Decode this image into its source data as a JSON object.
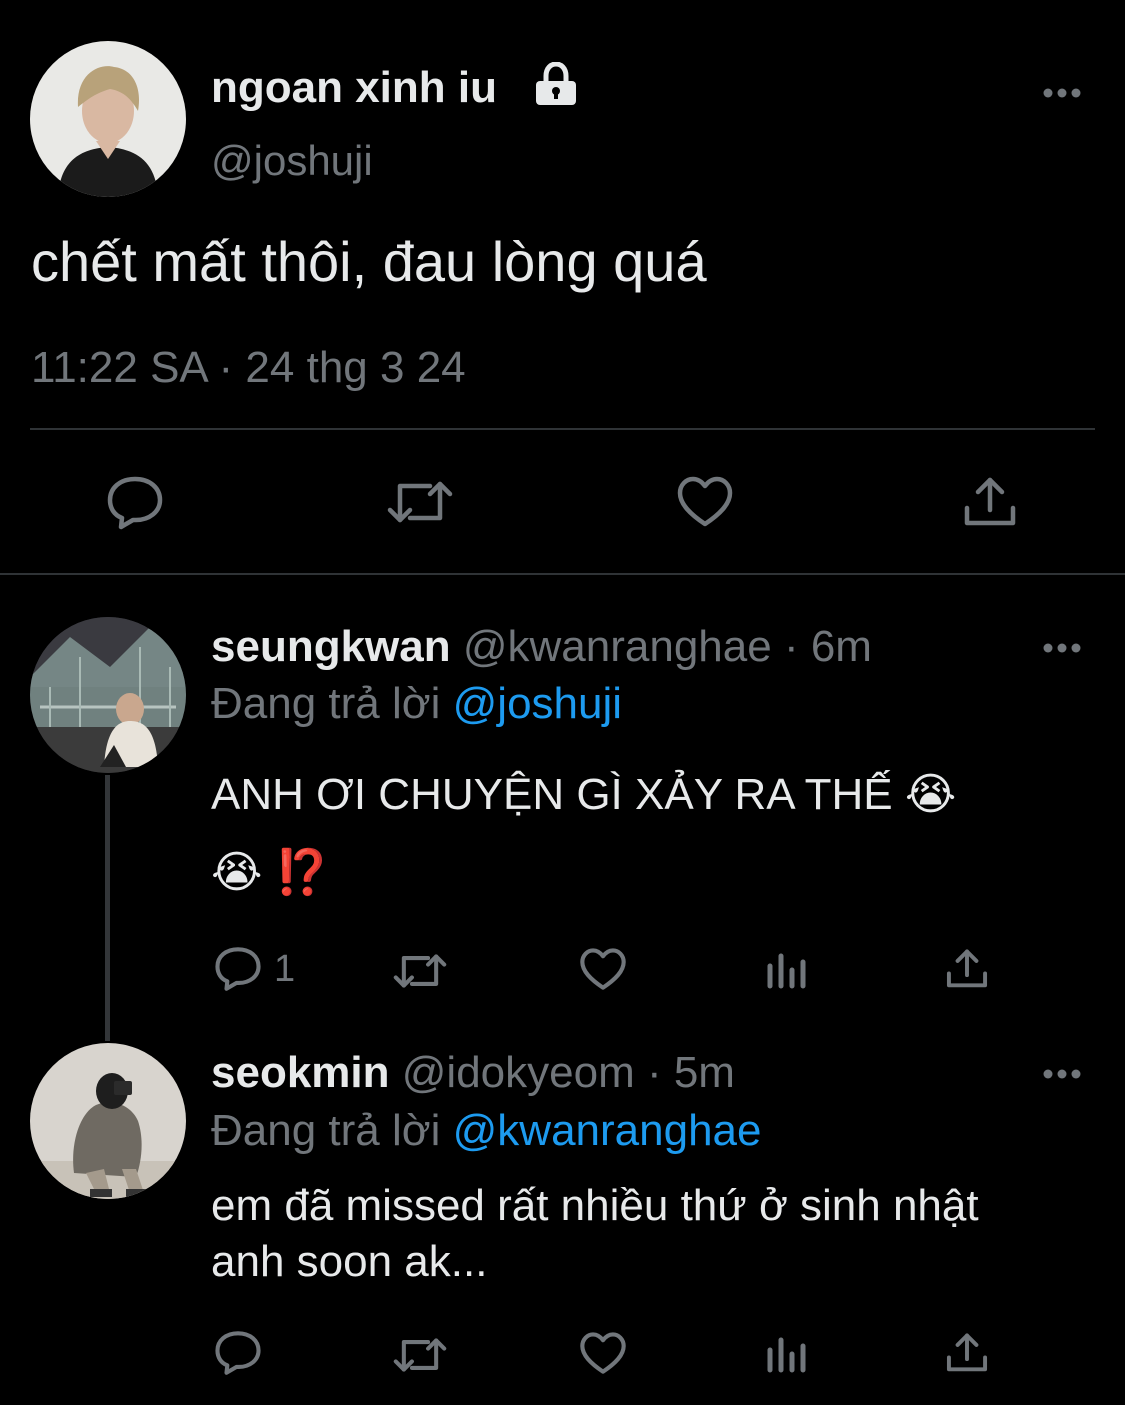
{
  "main_tweet": {
    "display_name": "ngoan xinh iu",
    "handle": "@joshuji",
    "text": "chết mất thôi, đau lòng quá",
    "timestamp": "11:22 SA · 24 thg 3 24",
    "icons": [
      "reply-icon",
      "retweet-icon",
      "like-icon",
      "share-icon"
    ]
  },
  "replies": [
    {
      "display_name": "seungkwan",
      "meta": "@kwanranghae · 6m",
      "replying_prefix": "Đang trả lời",
      "replying_to": "@joshuji",
      "text_line1": "ANH ƠI CHUYỆN GÌ XẢY RA THẾ 😭",
      "text_line2": "😭 ⁉️",
      "reply_count": "1"
    },
    {
      "display_name": "seokmin",
      "meta": "@idokyeom · 5m",
      "replying_prefix": "Đang trả lời",
      "replying_to": "@kwanranghae",
      "text_line1": "em đã missed rất nhiều thứ ở sinh nhật",
      "text_line2": "anh soon ak...",
      "reply_count": ""
    }
  ],
  "colors": {
    "background": "#000000",
    "text": "#e7e9ea",
    "muted": "#71767b",
    "link": "#1d9bf0",
    "divider": "#2f3336"
  }
}
